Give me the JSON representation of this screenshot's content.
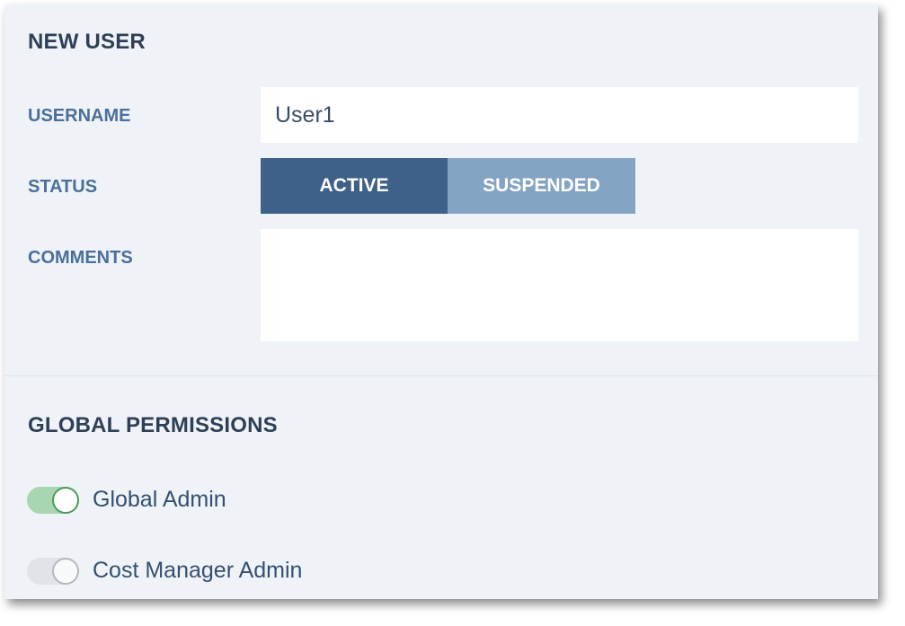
{
  "form": {
    "title": "NEW USER",
    "username_label": "USERNAME",
    "username_value": "User1",
    "status_label": "STATUS",
    "status_options": [
      "ACTIVE",
      "SUSPENDED"
    ],
    "status_selected": "ACTIVE",
    "comments_label": "COMMENTS",
    "comments_value": ""
  },
  "permissions": {
    "title": "GLOBAL PERMISSIONS",
    "items": [
      {
        "label": "Global Admin",
        "enabled": true
      },
      {
        "label": "Cost Manager Admin",
        "enabled": false
      }
    ]
  },
  "colors": {
    "active_segment": "#3e6189",
    "inactive_segment": "#84a4c3",
    "toggle_on": "#a8d5b2",
    "toggle_on_border": "#4c9a5c",
    "toggle_off": "#e0e3e8"
  }
}
